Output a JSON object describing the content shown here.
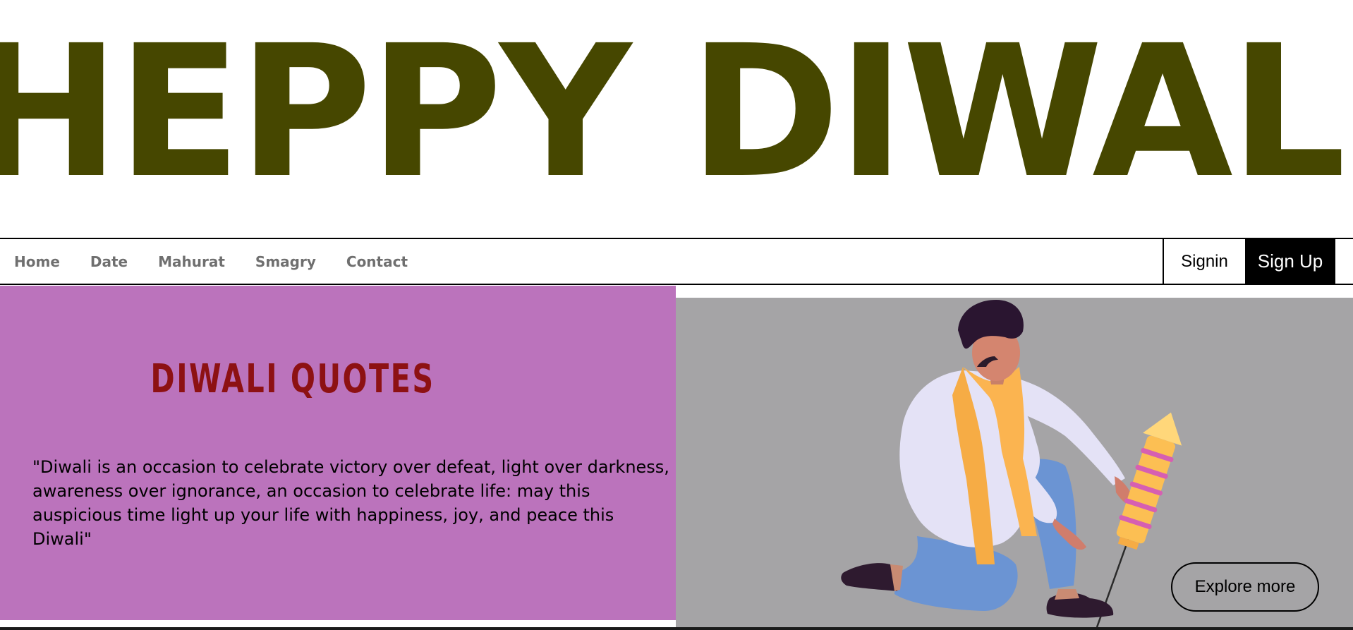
{
  "banner": {
    "title": "HEPPY DIWALI"
  },
  "nav": {
    "links": [
      "Home",
      "Date",
      "Mahurat",
      "Smagry",
      "Contact"
    ],
    "signin_label": "Signin",
    "signup_label": "Sign Up"
  },
  "quotes": {
    "heading": "DIWALI QUOTES",
    "text": "\"Diwali is an occasion to celebrate victory over defeat, light over darkness, awareness over ignorance, an occasion to celebrate life: may this auspicious time light up your life with happiness, joy, and peace this Diwali\""
  },
  "hero": {
    "illustration": "man-lighting-rocket-firecracker-illustration",
    "explore_label": "Explore more"
  },
  "colors": {
    "title": "#464700",
    "panel": "#bb73bc",
    "heading": "#8d1113",
    "image_background": "#a5a4a6"
  }
}
